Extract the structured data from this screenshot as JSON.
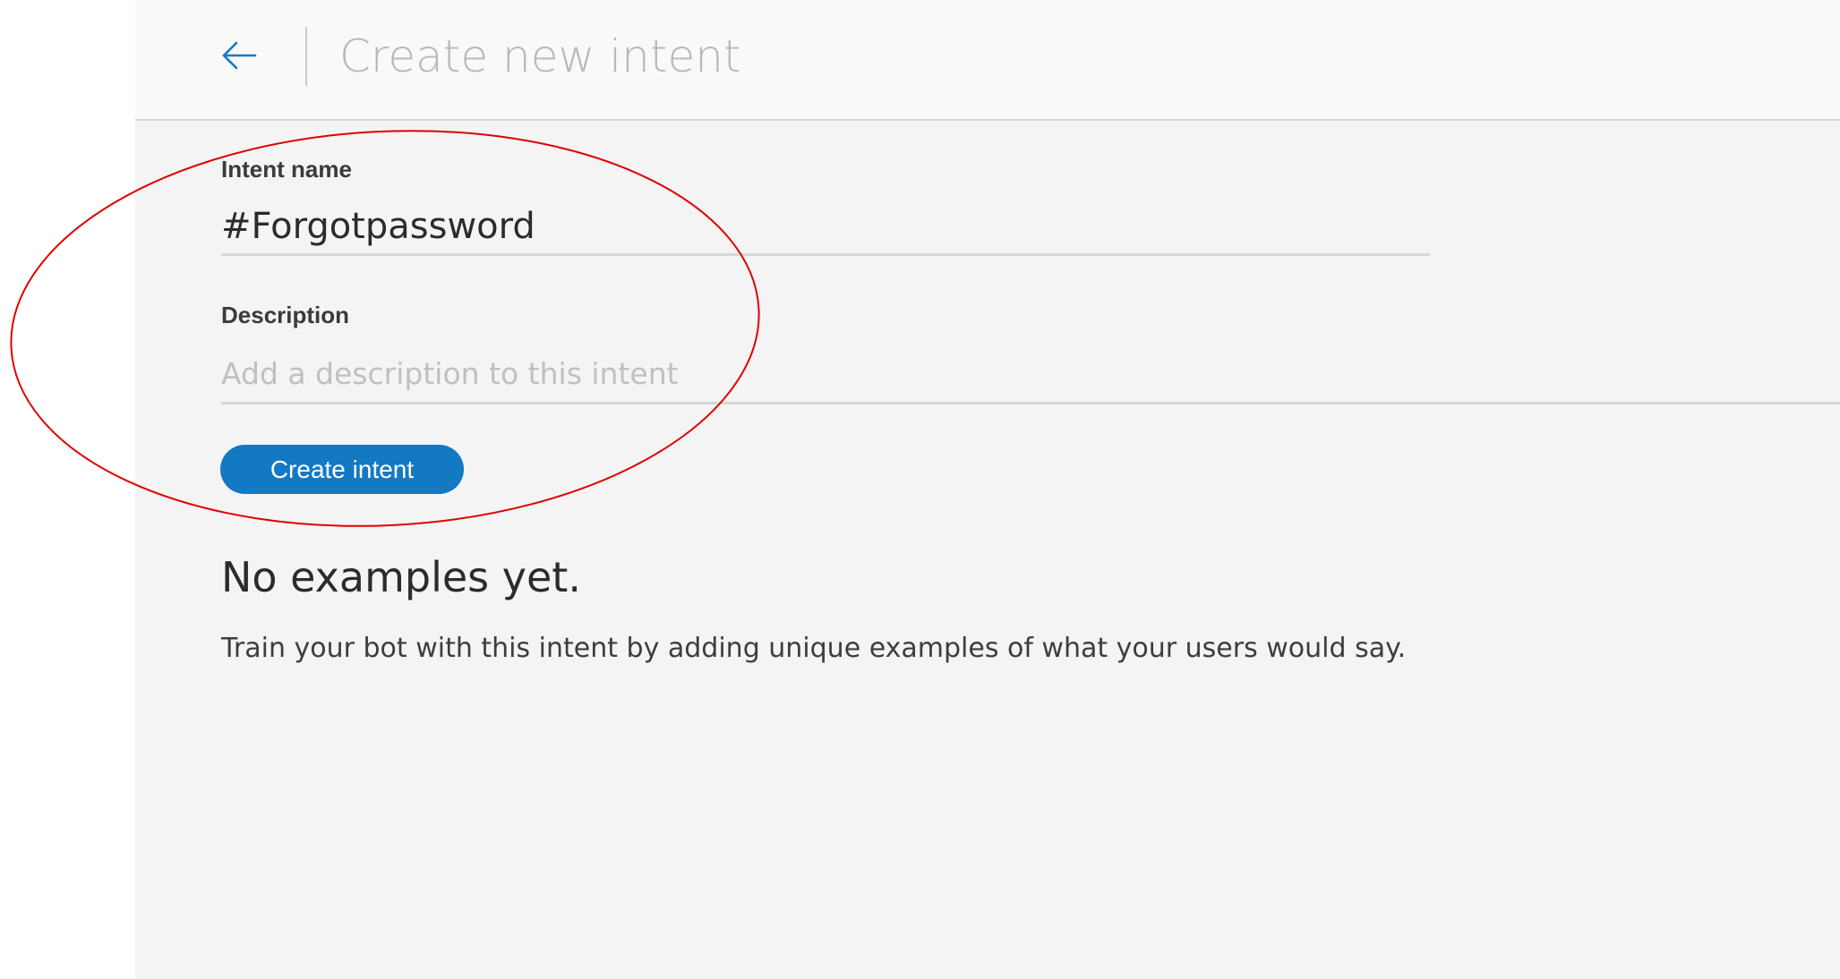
{
  "header": {
    "back_icon": "arrow-left-icon",
    "title": "Create new intent"
  },
  "form": {
    "intent_name_label": "Intent name",
    "intent_name_value": "#Forgotpassword",
    "description_label": "Description",
    "description_placeholder": "Add a description to this intent",
    "description_value": "",
    "create_button_label": "Create intent"
  },
  "empty_state": {
    "title": "No examples yet.",
    "text": "Train your bot with this intent by adding unique examples of what your users would say."
  },
  "colors": {
    "accent": "#1479c3",
    "annotation": "#e00000",
    "panel_background": "#f4f4f4"
  }
}
